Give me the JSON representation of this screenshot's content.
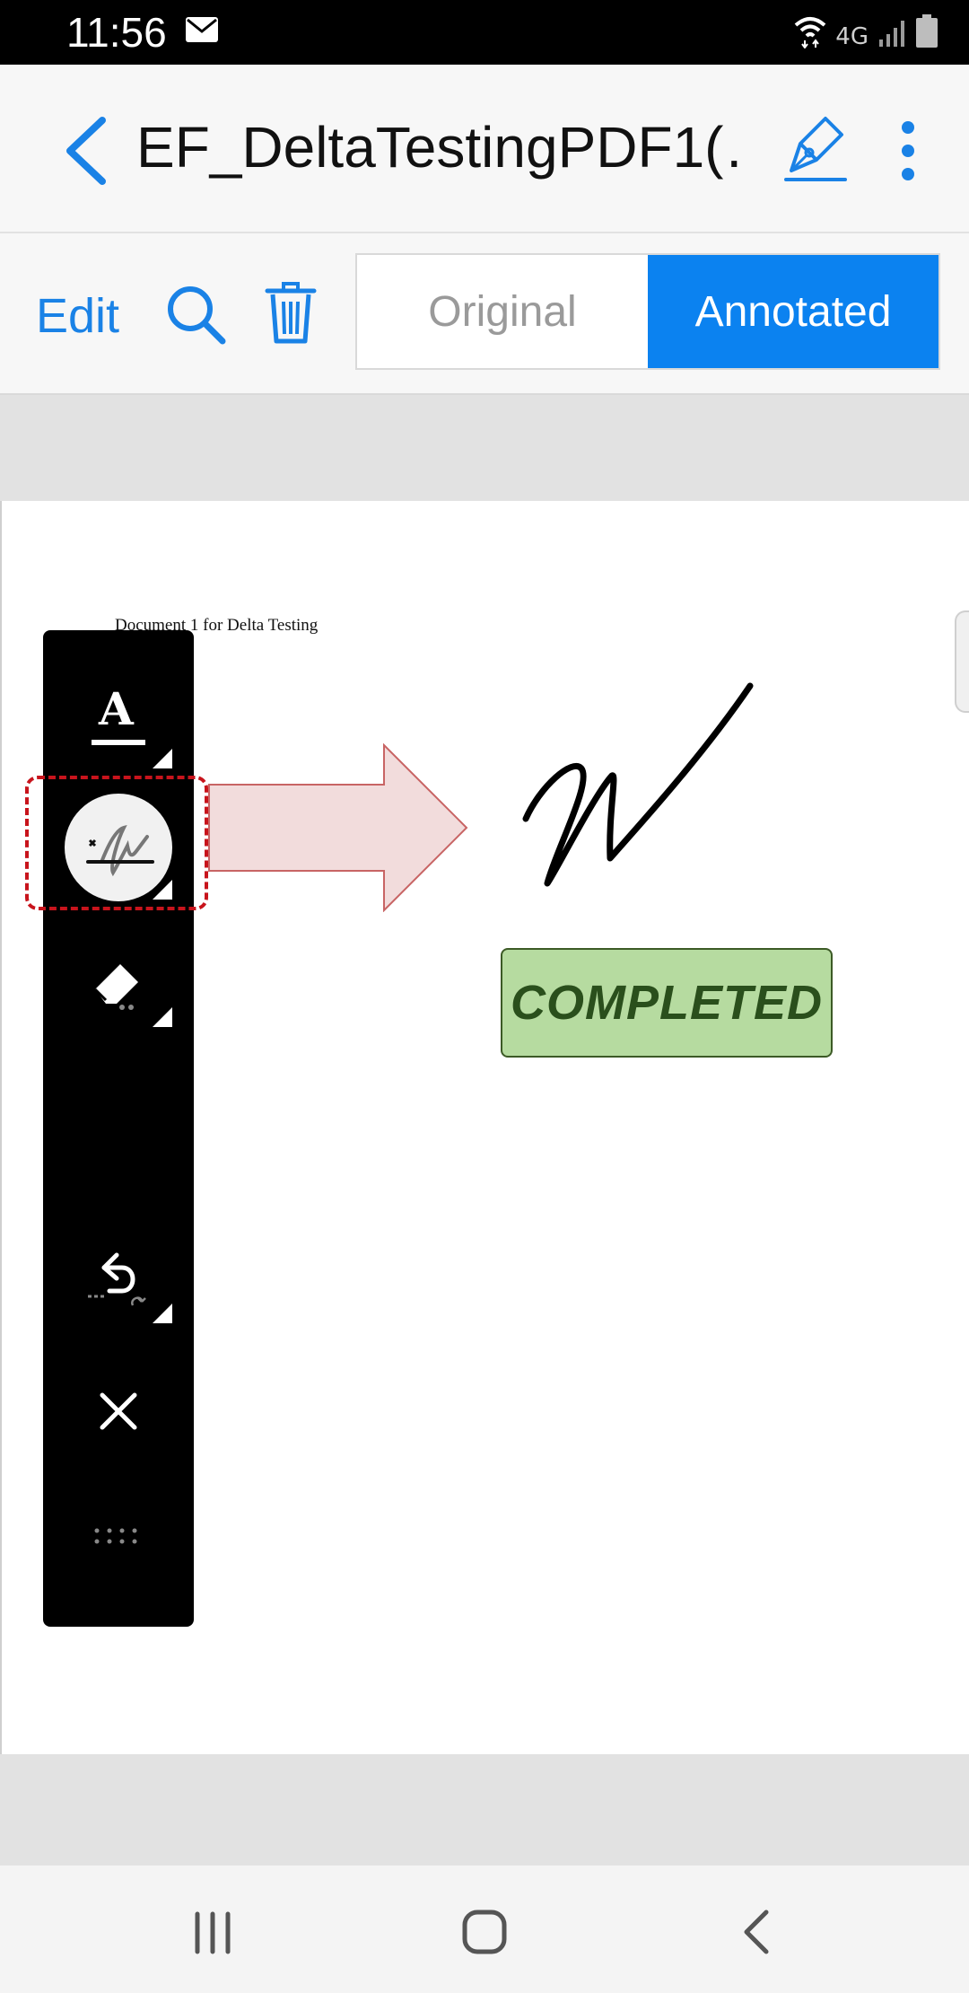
{
  "status_bar": {
    "time": "11:56",
    "network_label": "4G",
    "icons": [
      "mail-icon",
      "wifi-icon",
      "signal-icon",
      "battery-icon"
    ]
  },
  "app_bar": {
    "title": "EF_DeltaTestingPDF1(…",
    "icons": [
      "back-arrow-icon",
      "pen-sign-icon",
      "more-vertical-icon"
    ]
  },
  "toolbar": {
    "edit_label": "Edit",
    "search_icon": "search-icon",
    "trash_icon": "trash-icon",
    "segments": [
      {
        "label": "Original",
        "selected": false
      },
      {
        "label": "Annotated",
        "selected": true
      }
    ]
  },
  "document": {
    "heading": "Document 1 for Delta Testing",
    "stamp_text": "COMPLETED"
  },
  "annotation_toolbar": {
    "tools": [
      {
        "name": "text-tool",
        "icon": "text-A-icon"
      },
      {
        "name": "signature-tool",
        "icon": "signature-icon",
        "selected": true
      },
      {
        "name": "eraser-tool",
        "icon": "eraser-icon"
      },
      {
        "name": "undo-tool",
        "icon": "undo-icon"
      },
      {
        "name": "close-tool",
        "icon": "close-icon"
      },
      {
        "name": "drag-handle",
        "icon": "grip-icon"
      }
    ],
    "text_tool_glyph": "A"
  },
  "colors": {
    "accent": "#1a82e6",
    "segment_active": "#0b82f0",
    "stamp_fill": "#b6dba0",
    "stamp_text": "#2a4f1c",
    "highlight": "#c8141c",
    "arrow_fill": "#f2dcdc",
    "arrow_stroke": "#c86464"
  },
  "nav_bar": {
    "icons": [
      "recents-icon",
      "home-icon",
      "back-icon"
    ]
  }
}
